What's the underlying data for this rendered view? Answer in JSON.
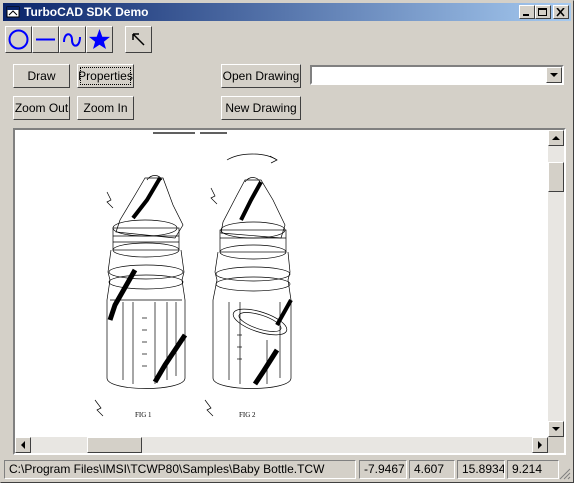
{
  "window": {
    "title": "TurboCAD SDK Demo"
  },
  "toolbar": {
    "tools": [
      {
        "icon": "circle-icon"
      },
      {
        "icon": "line-icon"
      },
      {
        "icon": "curve-icon"
      },
      {
        "icon": "star-icon"
      },
      {
        "icon": "arrow-select-icon"
      }
    ]
  },
  "buttons": {
    "draw": "Draw",
    "properties": "Properties",
    "zoom_out": "Zoom Out",
    "zoom_in": "Zoom In",
    "open_drawing": "Open Drawing",
    "new_drawing": "New Drawing"
  },
  "combo": {
    "value": ""
  },
  "drawing": {
    "fig1_label": "FIG 1",
    "fig2_label": "FIG 2"
  },
  "statusbar": {
    "path": "C:\\Program Files\\IMSI\\TCWP80\\Samples\\Baby Bottle.TCW",
    "x": "-7.9467",
    "y": "4.607",
    "w": "15.8934",
    "h": "9.214"
  },
  "colors": {
    "accent": "#0000ff",
    "titlebar": "#0a246a"
  }
}
